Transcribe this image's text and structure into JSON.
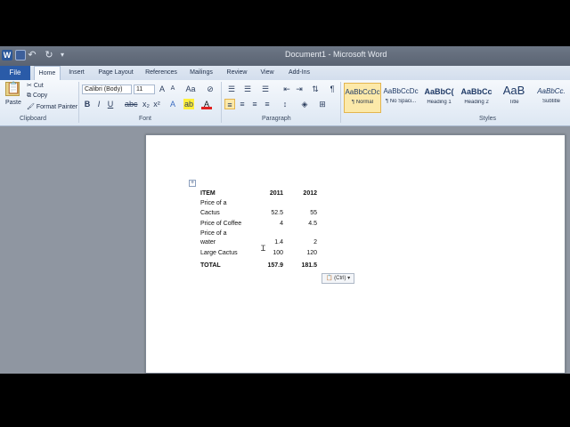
{
  "window": {
    "title": "Document1 - Microsoft Word",
    "word_icon": "W",
    "save_icon": "save-icon",
    "undo_icon": "undo-icon",
    "redo_icon": "redo-icon"
  },
  "tabs": [
    "File",
    "Home",
    "Insert",
    "Page Layout",
    "References",
    "Mailings",
    "Review",
    "View",
    "Add-Ins"
  ],
  "active_tab": "Home",
  "ribbon": {
    "clipboard": {
      "paste_label": "Paste",
      "cut_label": "Cut",
      "copy_label": "Copy",
      "format_painter_label": "Format Painter",
      "group_label": "Clipboard"
    },
    "font": {
      "font_name": "Calibri (Body)",
      "font_size": "11",
      "group_label": "Font"
    },
    "paragraph": {
      "group_label": "Paragraph"
    },
    "styles": {
      "group_label": "Styles",
      "items": [
        {
          "sample": "AaBbCcDc",
          "name": "¶ Normal"
        },
        {
          "sample": "AaBbCcDc",
          "name": "¶ No Spaci..."
        },
        {
          "sample": "AaBbC(",
          "name": "Heading 1"
        },
        {
          "sample": "AaBbCc",
          "name": "Heading 2"
        },
        {
          "sample": "AaB",
          "name": "Title"
        },
        {
          "sample": "AaBbCc.",
          "name": "Subtitle"
        }
      ]
    }
  },
  "table": {
    "headers": [
      "ITEM",
      "2011",
      "2012"
    ],
    "rows": [
      {
        "item_line1": "Price of a",
        "item_line2": "Cactus",
        "y2011": "52.5",
        "y2012": "55"
      },
      {
        "item_line1": "Price of Coffee",
        "item_line2": "",
        "y2011": "4",
        "y2012": "4.5"
      },
      {
        "item_line1": "Price of a",
        "item_line2": "water",
        "y2011": "1.4",
        "y2012": "2"
      },
      {
        "item_line1": "Large Cactus",
        "item_line2": "",
        "y2011": "100",
        "y2012": "120"
      }
    ],
    "total": {
      "label": "TOTAL",
      "y2011": "157.9",
      "y2012": "181.5"
    }
  },
  "paste_options_label": "(Ctrl)",
  "colors": {
    "file_tab": "#2a5ba8",
    "ribbon": "#dde7f3",
    "workspace": "#8f96a1"
  }
}
